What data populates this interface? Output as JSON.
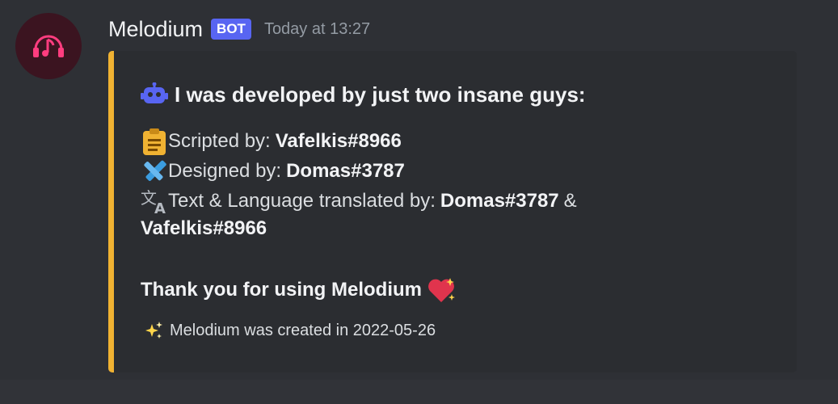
{
  "message": {
    "username": "Melodium",
    "badge": "BOT",
    "timestamp": "Today at 13:27"
  },
  "embed": {
    "accent_color": "#f0b232",
    "title": "I was developed by just two insane guys:",
    "credits": [
      {
        "label": "Scripted by:",
        "value": "Vafelkis#8966",
        "icon": "clipboard-icon"
      },
      {
        "label": "Designed by:",
        "value": "Domas#3787",
        "icon": "pencil-ruler-icon"
      },
      {
        "label": "Text & Language translated by:",
        "value": "Domas#3787",
        "connector": "&",
        "value2": "Vafelkis#8966",
        "icon": "translate-icon"
      }
    ],
    "thanks": "Thank you for using Melodium",
    "footer": "Melodium was created in 2022-05-26"
  },
  "colors": {
    "background": "#313338",
    "embed_bg": "#2b2d31",
    "badge": "#5865f2",
    "avatar_bg": "#3b1420",
    "avatar_icon": "#ff3d7f"
  }
}
